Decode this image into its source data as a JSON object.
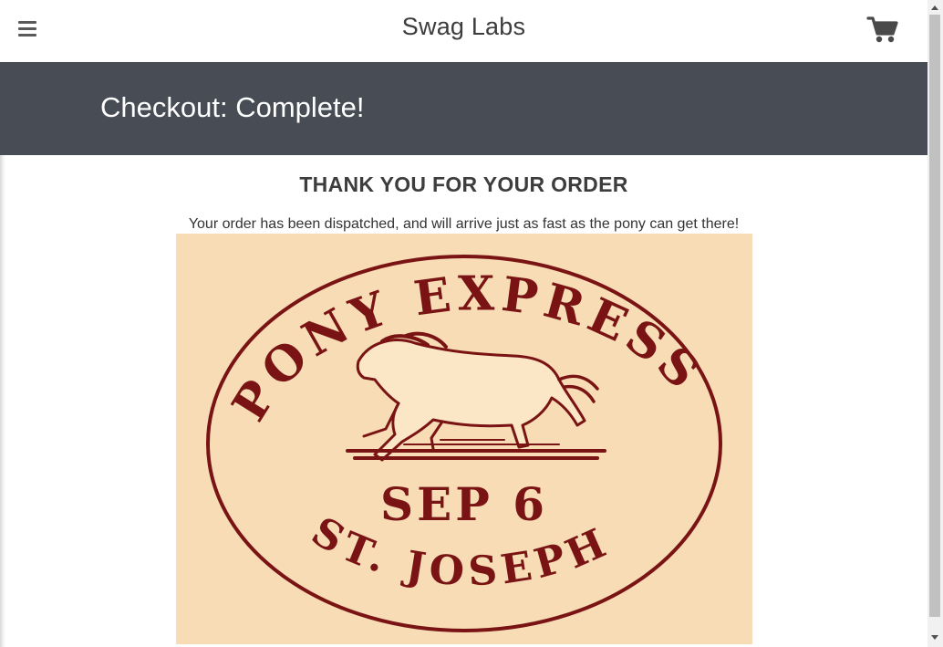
{
  "header": {
    "brand": "Swag Labs",
    "menu_icon": "hamburger-menu-icon",
    "cart_icon": "shopping-cart-icon"
  },
  "secondary_header": {
    "title": "Checkout: Complete!"
  },
  "checkout_complete": {
    "heading": "THANK YOU FOR YOUR ORDER",
    "message": "Your order has been dispatched, and will arrive just as fast as the pony can get there!",
    "image": {
      "stamp_top_text": "PONY EXPRESS",
      "stamp_date": "SEP 6",
      "stamp_bottom_text": "ST. JOSEPH"
    }
  },
  "colors": {
    "secondary_header_bg": "#474c55",
    "stamp_ink": "#7a1414",
    "stamp_paper": "#f7dcb5"
  }
}
